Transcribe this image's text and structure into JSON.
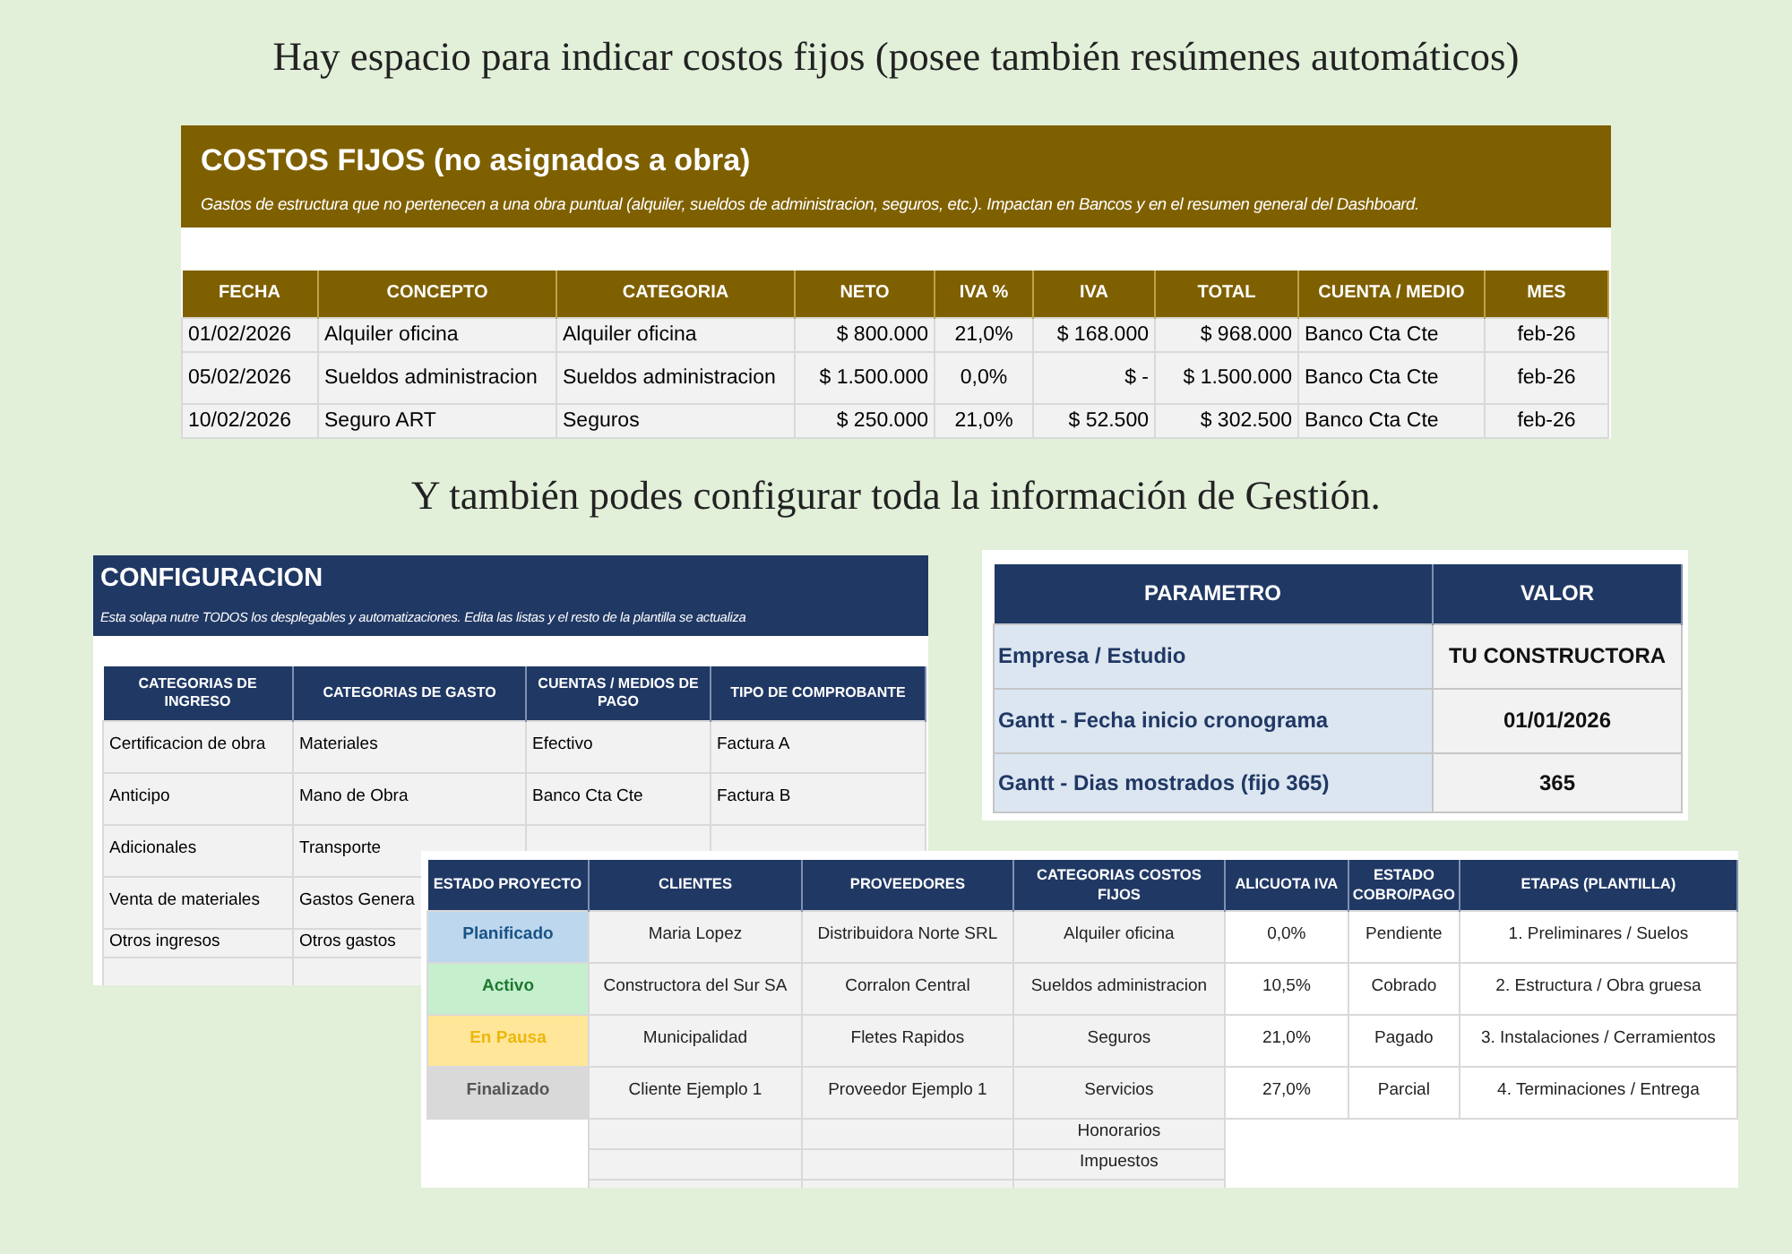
{
  "captions": [
    "Hay espacio para indicar costos fijos (posee también resúmenes automáticos)",
    "Y también podes configurar toda la información de Gestión."
  ],
  "costos_fijos": {
    "title": "COSTOS FIJOS (no asignados a obra)",
    "subtitle": "Gastos de estructura que no pertenecen a una obra puntual (alquiler, sueldos de administracion, seguros, etc.). Impactan en Bancos y en el resumen general del Dashboard.",
    "columns": [
      "FECHA",
      "CONCEPTO",
      "CATEGORIA",
      "NETO",
      "IVA %",
      "IVA",
      "TOTAL",
      "CUENTA / MEDIO",
      "MES"
    ],
    "rows": [
      [
        "01/02/2026",
        "Alquiler oficina",
        "Alquiler oficina",
        "$ 800.000",
        "21,0%",
        "$ 168.000",
        "$ 968.000",
        "Banco Cta Cte",
        "feb-26"
      ],
      [
        "05/02/2026",
        "Sueldos administracion",
        "Sueldos administracion",
        "$ 1.500.000",
        "0,0%",
        "$ -",
        "$ 1.500.000",
        "Banco Cta Cte",
        "feb-26"
      ],
      [
        "10/02/2026",
        "Seguro ART",
        "Seguros",
        "$ 250.000",
        "21,0%",
        "$ 52.500",
        "$ 302.500",
        "Banco Cta Cte",
        "feb-26"
      ]
    ]
  },
  "configuracion": {
    "title": "CONFIGURACION",
    "subtitle": "Esta solapa nutre TODOS los desplegables y automatizaciones. Edita las listas y el resto de la plantilla se actualiza",
    "columns": [
      "CATEGORIAS DE INGRESO",
      "CATEGORIAS DE GASTO",
      "CUENTAS / MEDIOS DE PAGO",
      "TIPO DE COMPROBANTE"
    ],
    "rows": [
      [
        "Certificacion de obra",
        "Materiales",
        "Efectivo",
        "Factura A"
      ],
      [
        "Anticipo",
        "Mano de Obra",
        "Banco Cta Cte",
        "Factura B"
      ],
      [
        "Adicionales",
        "Transporte",
        "",
        ""
      ],
      [
        "Venta de materiales",
        "Gastos Genera",
        "",
        ""
      ],
      [
        "Otros ingresos",
        "Otros gastos",
        "",
        ""
      ]
    ]
  },
  "parametros": {
    "columns": [
      "PARAMETRO",
      "VALOR"
    ],
    "rows": [
      [
        "Empresa / Estudio",
        "TU CONSTRUCTORA"
      ],
      [
        "Gantt - Fecha inicio cronograma",
        "01/01/2026"
      ],
      [
        "Gantt - Dias mostrados (fijo 365)",
        "365"
      ]
    ]
  },
  "listas": {
    "columns": [
      "ESTADO PROYECTO",
      "CLIENTES",
      "PROVEEDORES",
      "CATEGORIAS COSTOS FIJOS",
      "ALICUOTA IVA",
      "ESTADO COBRO/PAGO",
      "ETAPAS (PLANTILLA)"
    ],
    "rows": [
      {
        "color": "#bdd7ee",
        "cells": [
          "Planificado",
          "Maria Lopez",
          "Distribuidora Norte SRL",
          "Alquiler oficina",
          "0,0%",
          "Pendiente",
          "1. Preliminares / Suelos"
        ]
      },
      {
        "color": "#c6efce",
        "cells": [
          "Activo",
          "Constructora del Sur SA",
          "Corralon Central",
          "Sueldos administracion",
          "10,5%",
          "Cobrado",
          "2. Estructura / Obra gruesa"
        ]
      },
      {
        "color": "#ffe699",
        "cells": [
          "En Pausa",
          "Municipalidad",
          "Fletes Rapidos",
          "Seguros",
          "21,0%",
          "Pagado",
          "3. Instalaciones / Cerramientos"
        ]
      },
      {
        "color": "#d9d9d9",
        "cells": [
          "Finalizado",
          "Cliente Ejemplo 1",
          "Proveedor Ejemplo 1",
          "Servicios",
          "27,0%",
          "Parcial",
          "4. Terminaciones / Entrega"
        ]
      }
    ],
    "extra_rows": [
      [
        "",
        "",
        "",
        "Honorarios"
      ],
      [
        "",
        "",
        "",
        "Impuestos"
      ]
    ]
  }
}
